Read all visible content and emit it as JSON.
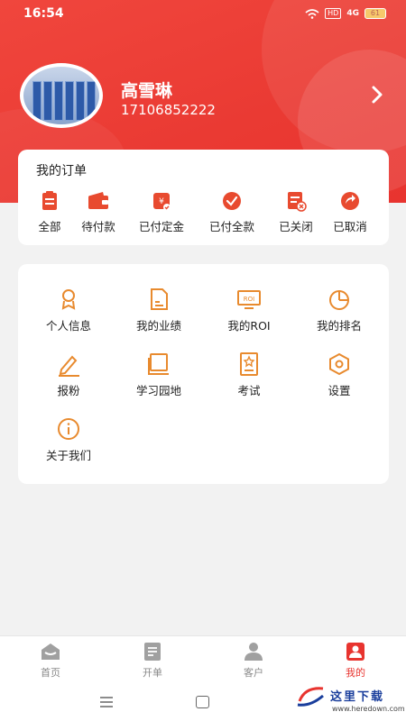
{
  "status_bar": {
    "time": "16:54",
    "hd": "HD",
    "signal": "4G",
    "battery": "61"
  },
  "profile": {
    "name": "高雪琳",
    "phone": "17106852222"
  },
  "orders": {
    "title": "我的订单",
    "items": [
      {
        "label": "全部",
        "icon": "clipboard-icon"
      },
      {
        "label": "待付款",
        "icon": "wallet-icon"
      },
      {
        "label": "已付定金",
        "icon": "deposit-icon"
      },
      {
        "label": "已付全款",
        "icon": "check-circle-icon"
      },
      {
        "label": "已关闭",
        "icon": "closed-icon"
      },
      {
        "label": "已取消",
        "icon": "cancel-icon"
      }
    ]
  },
  "menu": {
    "items": [
      {
        "label": "个人信息",
        "icon": "person-icon"
      },
      {
        "label": "我的业绩",
        "icon": "document-icon"
      },
      {
        "label": "我的ROI",
        "icon": "roi-icon"
      },
      {
        "label": "我的排名",
        "icon": "pie-chart-icon"
      },
      {
        "label": "报粉",
        "icon": "pen-icon"
      },
      {
        "label": "学习园地",
        "icon": "book-icon"
      },
      {
        "label": "考试",
        "icon": "exam-icon"
      },
      {
        "label": "设置",
        "icon": "settings-icon"
      },
      {
        "label": "关于我们",
        "icon": "info-icon"
      }
    ]
  },
  "tabbar": {
    "items": [
      {
        "label": "首页",
        "icon": "home-icon",
        "active": false
      },
      {
        "label": "开单",
        "icon": "order-form-icon",
        "active": false
      },
      {
        "label": "客户",
        "icon": "customer-icon",
        "active": false
      },
      {
        "label": "我的",
        "icon": "mine-icon",
        "active": true
      }
    ]
  },
  "watermark": {
    "text": "这里下载",
    "url": "www.heredown.com"
  },
  "colors": {
    "primary": "#e8342f",
    "icon_orange": "#e88a2e",
    "icon_red": "#e84a2f",
    "background": "#f2f2f2"
  }
}
